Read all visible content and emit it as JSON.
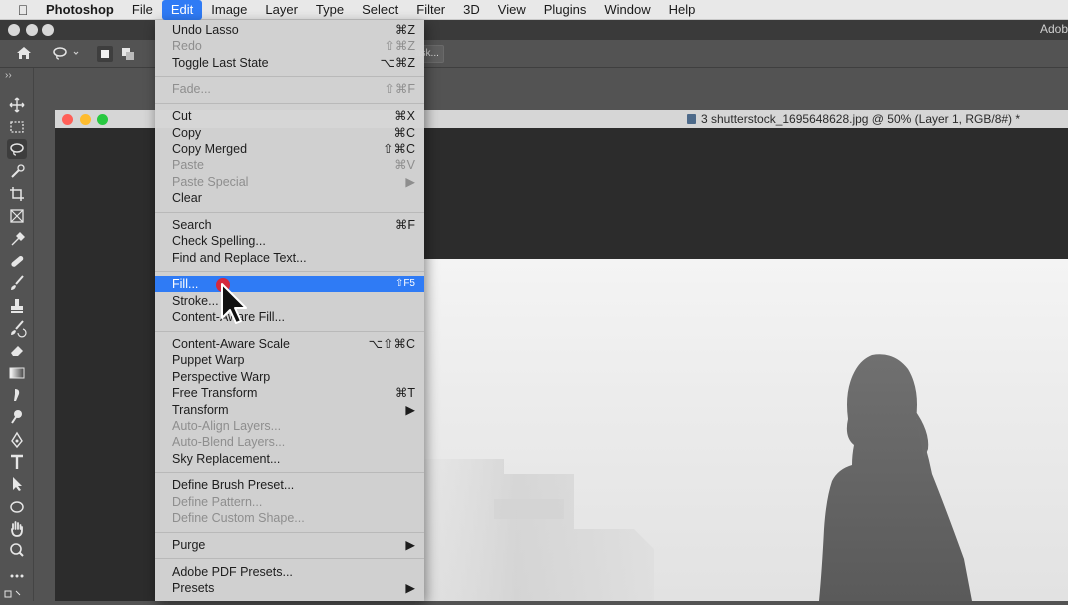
{
  "menubar": {
    "app": "Photoshop",
    "items": [
      "File",
      "Edit",
      "Image",
      "Layer",
      "Type",
      "Select",
      "Filter",
      "3D",
      "View",
      "Plugins",
      "Window",
      "Help"
    ],
    "active": "Edit"
  },
  "window": {
    "right_title": "Adob"
  },
  "options": {
    "mask_label": "ask..."
  },
  "document": {
    "title": "3 shutterstock_1695648628.jpg @ 50% (Layer 1, RGB/8#) *"
  },
  "edit_menu": {
    "undo": {
      "label": "Undo Lasso",
      "shortcut": "⌘Z"
    },
    "redo": {
      "label": "Redo",
      "shortcut": "⇧⌘Z"
    },
    "toggle": {
      "label": "Toggle Last State",
      "shortcut": "⌥⌘Z"
    },
    "fade": {
      "label": "Fade...",
      "shortcut": "⇧⌘F"
    },
    "cut": {
      "label": "Cut",
      "shortcut": "⌘X"
    },
    "copy": {
      "label": "Copy",
      "shortcut": "⌘C"
    },
    "copy_merged": {
      "label": "Copy Merged",
      "shortcut": "⇧⌘C"
    },
    "paste": {
      "label": "Paste",
      "shortcut": "⌘V"
    },
    "paste_special": {
      "label": "Paste Special",
      "shortcut": "▶"
    },
    "clear": {
      "label": "Clear",
      "shortcut": ""
    },
    "search": {
      "label": "Search",
      "shortcut": "⌘F"
    },
    "check_spelling": {
      "label": "Check Spelling...",
      "shortcut": ""
    },
    "find_replace": {
      "label": "Find and Replace Text...",
      "shortcut": ""
    },
    "fill": {
      "label": "Fill...",
      "shortcut": "⇧F5"
    },
    "stroke": {
      "label": "Stroke...",
      "shortcut": ""
    },
    "content_aware_fill": {
      "label": "Content-Aware Fill...",
      "shortcut": ""
    },
    "content_aware_scale": {
      "label": "Content-Aware Scale",
      "shortcut": "⌥⇧⌘C"
    },
    "puppet_warp": {
      "label": "Puppet Warp",
      "shortcut": ""
    },
    "perspective_warp": {
      "label": "Perspective Warp",
      "shortcut": ""
    },
    "free_transform": {
      "label": "Free Transform",
      "shortcut": "⌘T"
    },
    "transform": {
      "label": "Transform",
      "shortcut": "▶"
    },
    "auto_align": {
      "label": "Auto-Align Layers...",
      "shortcut": ""
    },
    "auto_blend": {
      "label": "Auto-Blend Layers...",
      "shortcut": ""
    },
    "sky_replacement": {
      "label": "Sky Replacement...",
      "shortcut": ""
    },
    "define_brush": {
      "label": "Define Brush Preset...",
      "shortcut": ""
    },
    "define_pattern": {
      "label": "Define Pattern...",
      "shortcut": ""
    },
    "define_shape": {
      "label": "Define Custom Shape...",
      "shortcut": ""
    },
    "purge": {
      "label": "Purge",
      "shortcut": "▶"
    },
    "pdf_presets": {
      "label": "Adobe PDF Presets...",
      "shortcut": ""
    },
    "presets": {
      "label": "Presets",
      "shortcut": "▶"
    }
  },
  "icons": {
    "apple": "apple-icon",
    "home": "home-icon",
    "lasso": "lasso-icon",
    "move": "move-icon",
    "marquee": "marquee-icon",
    "magic-wand": "quick-selection-icon",
    "crop": "crop-icon",
    "frame": "frame-icon",
    "eyedropper": "eyedropper-icon",
    "healing": "healing-icon",
    "brush": "brush-icon",
    "stamp": "clone-stamp-icon",
    "history": "history-brush-icon",
    "eraser": "eraser-icon",
    "gradient": "gradient-icon",
    "smudge": "smudge-icon",
    "dodge": "dodge-icon",
    "pen": "pen-icon",
    "type": "type-icon",
    "path": "path-selection-icon",
    "ellipse": "ellipse-icon",
    "hand": "hand-icon",
    "zoom": "zoom-icon",
    "more": "more-icon"
  },
  "colors": {
    "menu_highlight": "#2f7bf5",
    "close": "#ff5f57",
    "minimize": "#febc2e",
    "zoom": "#28c840"
  }
}
